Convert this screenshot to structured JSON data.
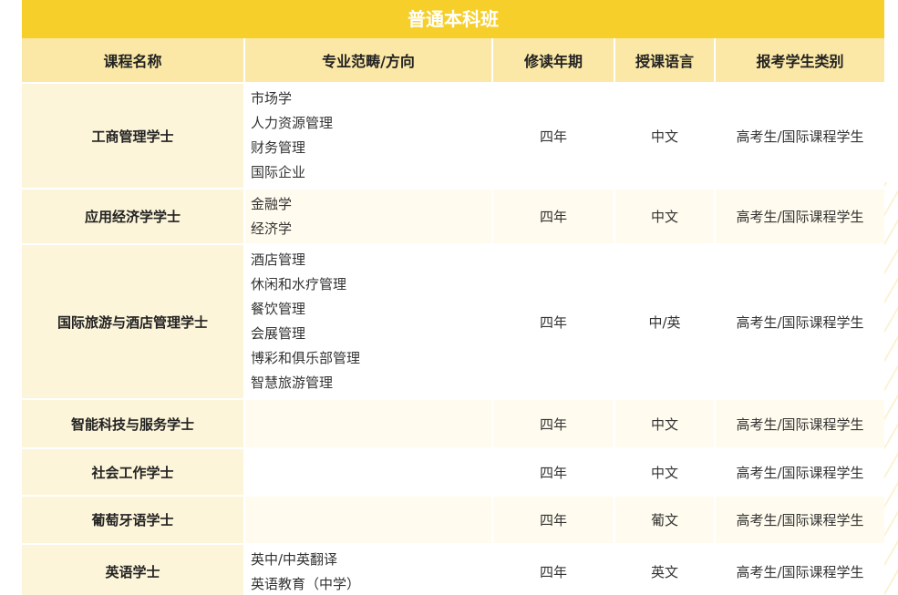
{
  "title": "普通本科班",
  "headers": [
    "课程名称",
    "专业范畴/方向",
    "修读年期",
    "授课语言",
    "报考学生类别"
  ],
  "rows": [
    {
      "name": "工商管理学士",
      "majors": [
        "市场学",
        "人力资源管理",
        "财务管理",
        "国际企业"
      ],
      "years": "四年",
      "language": "中文",
      "eligibility": "高考生/国际课程学生"
    },
    {
      "name": "应用经济学学士",
      "majors": [
        "金融学",
        "经济学"
      ],
      "years": "四年",
      "language": "中文",
      "eligibility": "高考生/国际课程学生"
    },
    {
      "name": "国际旅游与酒店管理学士",
      "majors": [
        "酒店管理",
        "休闲和水疗管理",
        "餐饮管理",
        "会展管理",
        "博彩和俱乐部管理",
        "智慧旅游管理"
      ],
      "years": "四年",
      "language": "中/英",
      "eligibility": "高考生/国际课程学生"
    },
    {
      "name": "智能科技与服务学士",
      "majors": [],
      "years": "四年",
      "language": "中文",
      "eligibility": "高考生/国际课程学生"
    },
    {
      "name": "社会工作学士",
      "majors": [],
      "years": "四年",
      "language": "中文",
      "eligibility": "高考生/国际课程学生"
    },
    {
      "name": "葡萄牙语学士",
      "majors": [],
      "years": "四年",
      "language": "葡文",
      "eligibility": "高考生/国际课程学生"
    },
    {
      "name": "英语学士",
      "majors": [
        "英中/中英翻译",
        "英语教育（中学）"
      ],
      "years": "四年",
      "language": "英文",
      "eligibility": "高考生/国际课程学生"
    }
  ]
}
